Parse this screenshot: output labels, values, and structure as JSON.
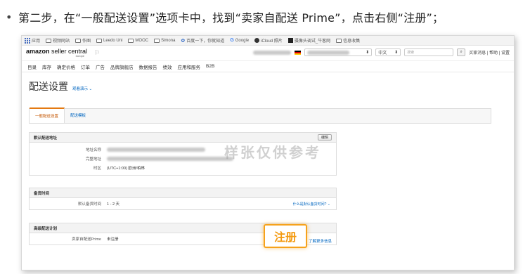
{
  "instruction": {
    "bullet": "•",
    "text": "第二步，在“一般配送设置”选项卡中，找到“卖家自配送 Prime”，点击右侧“注册”；"
  },
  "bookmarks": [
    {
      "icon": "apps-icon",
      "label": "应用"
    },
    {
      "icon": "folder-icon",
      "label": "视频网站"
    },
    {
      "icon": "folder-icon",
      "label": "作图"
    },
    {
      "icon": "folder-icon",
      "label": "Leedo Uni"
    },
    {
      "icon": "folder-icon",
      "label": "MOOC"
    },
    {
      "icon": "folder-icon",
      "label": "Simona"
    },
    {
      "icon": "star-icon",
      "label": "百度一下，你就知道"
    },
    {
      "icon": "google-icon",
      "label": "Google"
    },
    {
      "icon": "circle-icon",
      "label": "iCloud 照片"
    },
    {
      "icon": "square-icon",
      "label": "摄像头调试_牛客网"
    },
    {
      "icon": "folder-icon",
      "label": "信息收集"
    }
  ],
  "header": {
    "logo_main_bold": "amazon",
    "logo_main_rest": " seller central",
    "logo_sub": "europe",
    "language": "中文",
    "search_placeholder": "搜索",
    "search_icon": "search-icon",
    "links": "买家消息 | 帮助 | 设置"
  },
  "nav": [
    "目录",
    "库存",
    "确定价格",
    "订单",
    "广告",
    "品牌旗舰店",
    "数据报告",
    "绩效",
    "应用和服务",
    "B2B"
  ],
  "page": {
    "title": "配送设置",
    "learn_more": "观看演示 ⌄"
  },
  "tabs": [
    {
      "label": "一般配送设置",
      "active": true
    },
    {
      "label": "配送模板",
      "active": false
    }
  ],
  "default_address": {
    "title": "默认配送地址",
    "edit_label": "编辑",
    "rows": [
      {
        "label": "地址名称",
        "value": ""
      },
      {
        "label": "完整地址",
        "value": ""
      },
      {
        "label": "时区",
        "value": "(UTC+1:00) 欧洲/柏林"
      }
    ]
  },
  "handling_time": {
    "title": "备货时间",
    "rows": [
      {
        "label": "默认备货时间",
        "value": "1 - 2 天",
        "link": "什么是默认备货时间? ⌄"
      }
    ]
  },
  "advanced": {
    "title": "高级配送计划",
    "rows": [
      {
        "label": "卖家自配送Prime",
        "value": "未注册"
      }
    ]
  },
  "watermark": "样张仅供参考",
  "callout": {
    "label": "注册",
    "link": "了解更多信息",
    "accent_color": "#f6a21b"
  }
}
